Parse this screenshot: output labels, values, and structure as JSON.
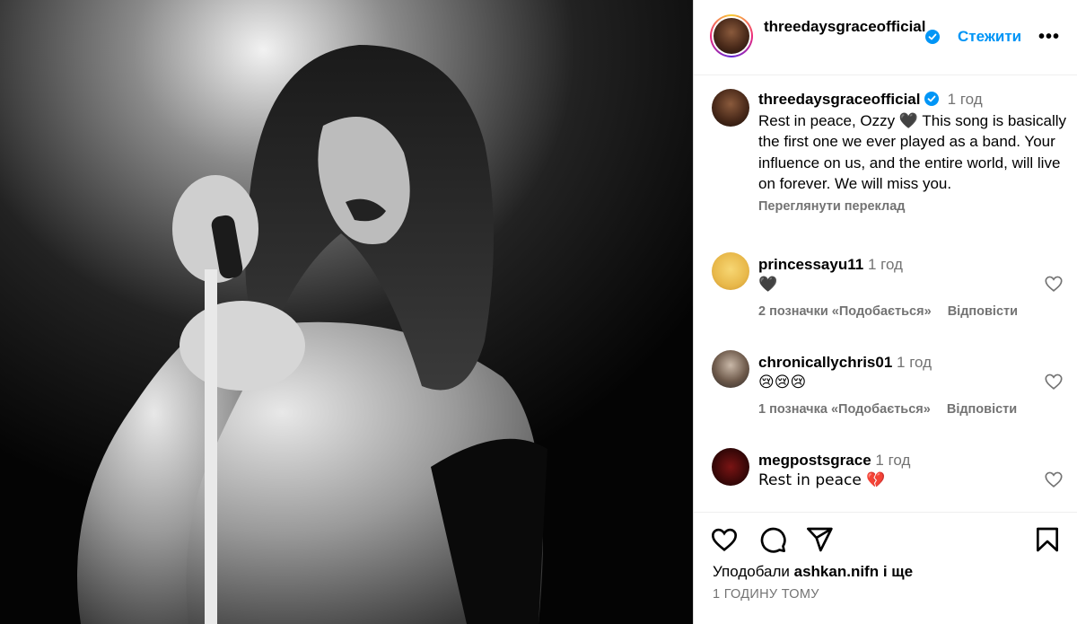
{
  "post": {
    "author": "threedaysgraceofficial",
    "follow_label": "Стежити",
    "more_label": "•••",
    "caption_time": "1 год",
    "caption_text": "Rest in peace, Ozzy 🖤 This song is basically the first one we ever played as a band. Your influence on us, and the entire world, will live on forever. We will miss you.",
    "translate_label": "Переглянути переклад"
  },
  "comments": [
    {
      "user": "princessayu11",
      "time": "1 год",
      "text": "🖤",
      "likes": "2 позначки «Подобається»",
      "reply": "Відповісти"
    },
    {
      "user": "chronicallychris01",
      "time": "1 год",
      "text": "😢😢😢",
      "likes": "1 позначка «Подобається»",
      "reply": "Відповісти"
    },
    {
      "user": "megpostsgrace",
      "time": "1 год",
      "text": "Rest in peace 💔",
      "likes": "",
      "reply": ""
    }
  ],
  "footer": {
    "liked_prefix": "Уподобали ",
    "liked_user": "ashkan.nifn",
    "liked_suffix": " і ще",
    "timestamp": "1 ГОДИНУ ТОМУ"
  },
  "colors": {
    "accent": "#0095f6",
    "muted": "#737373",
    "verified": "#0095f6"
  }
}
